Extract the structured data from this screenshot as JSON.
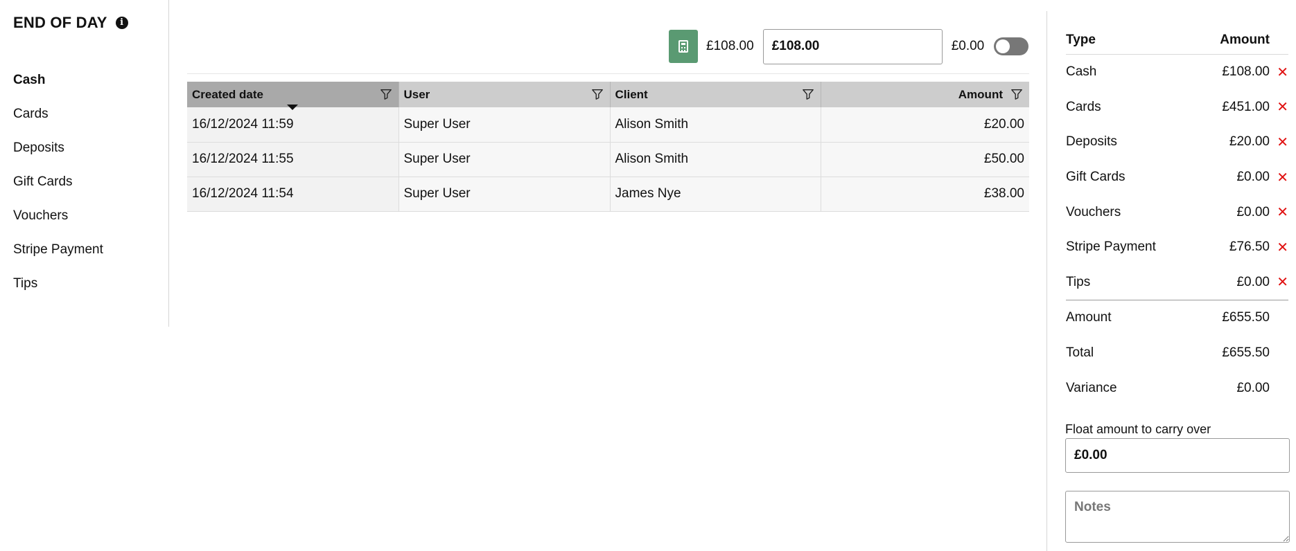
{
  "header": {
    "title": "END OF DAY",
    "info_icon": "info-icon"
  },
  "sidebar": {
    "items": [
      {
        "label": "Cash",
        "active": true
      },
      {
        "label": "Cards"
      },
      {
        "label": "Deposits"
      },
      {
        "label": "Gift Cards"
      },
      {
        "label": "Vouchers"
      },
      {
        "label": "Stripe Payment"
      },
      {
        "label": "Tips"
      }
    ]
  },
  "toolbar": {
    "calculator_icon": "calculator-icon",
    "expected": "£108.00",
    "counted_value": "£108.00",
    "difference": "£0.00",
    "toggle_on": false,
    "calculator_color": "#5a9a72"
  },
  "grid": {
    "columns": [
      "Created date",
      "User",
      "Client",
      "Amount"
    ],
    "sorted_column": "Created date",
    "rows": [
      {
        "date": "16/12/2024 11:59",
        "user": "Super User",
        "client": "Alison Smith",
        "amount": "£20.00"
      },
      {
        "date": "16/12/2024 11:55",
        "user": "Super User",
        "client": "Alison Smith",
        "amount": "£50.00"
      },
      {
        "date": "16/12/2024 11:54",
        "user": "Super User",
        "client": "James Nye",
        "amount": "£38.00"
      }
    ]
  },
  "summary": {
    "headers": {
      "type": "Type",
      "amount": "Amount"
    },
    "rows": [
      {
        "type": "Cash",
        "amount": "£108.00"
      },
      {
        "type": "Cards",
        "amount": "£451.00"
      },
      {
        "type": "Deposits",
        "amount": "£20.00"
      },
      {
        "type": "Gift Cards",
        "amount": "£0.00"
      },
      {
        "type": "Vouchers",
        "amount": "£0.00"
      },
      {
        "type": "Stripe Payment",
        "amount": "£76.50"
      },
      {
        "type": "Tips",
        "amount": "£0.00"
      }
    ],
    "totals": [
      {
        "type": "Amount",
        "amount": "£655.50"
      },
      {
        "type": "Total",
        "amount": "£655.50"
      },
      {
        "type": "Variance",
        "amount": "£0.00"
      }
    ],
    "remove_symbol": "✕",
    "remove_color": "#e01010"
  },
  "float": {
    "label": "Float amount to carry over",
    "value": "£0.00"
  },
  "notes": {
    "placeholder": "Notes"
  }
}
